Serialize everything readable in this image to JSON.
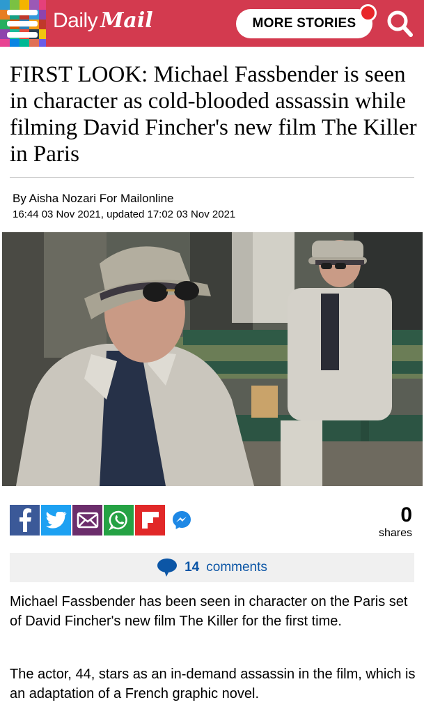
{
  "header": {
    "logo_daily": "Daily",
    "logo_mail": "Mail",
    "more_stories_label": "MORE STORIES",
    "colors": {
      "bar": "#d33a4f",
      "notification": "#e8272a"
    },
    "icons": [
      "menu-icon",
      "search-icon",
      "notification-dot"
    ]
  },
  "article": {
    "headline": "FIRST LOOK: Michael Fassbender is seen in character as cold-blooded assassin while filming David Fincher's new film The Killer in Paris",
    "byline_prefix": "By ",
    "author": "Aisha Nozari For Mailonline",
    "dateline": "16:44 03 Nov 2021, updated 17:02 03 Nov 2021",
    "paragraphs": [
      "Michael Fassbender has been seen in character on the Paris set of David Fincher's new film The Killer for the first time.",
      "The actor, 44, stars as an in-demand assassin in the film, which is an adaptation of a French graphic novel."
    ]
  },
  "share": {
    "buttons": [
      "facebook-icon",
      "twitter-icon",
      "email-icon",
      "whatsapp-icon",
      "flipboard-icon",
      "messenger-icon"
    ],
    "count": "0",
    "count_label": "shares"
  },
  "comments": {
    "count": "14",
    "label": "comments",
    "icon": "speech-bubble-icon"
  }
}
